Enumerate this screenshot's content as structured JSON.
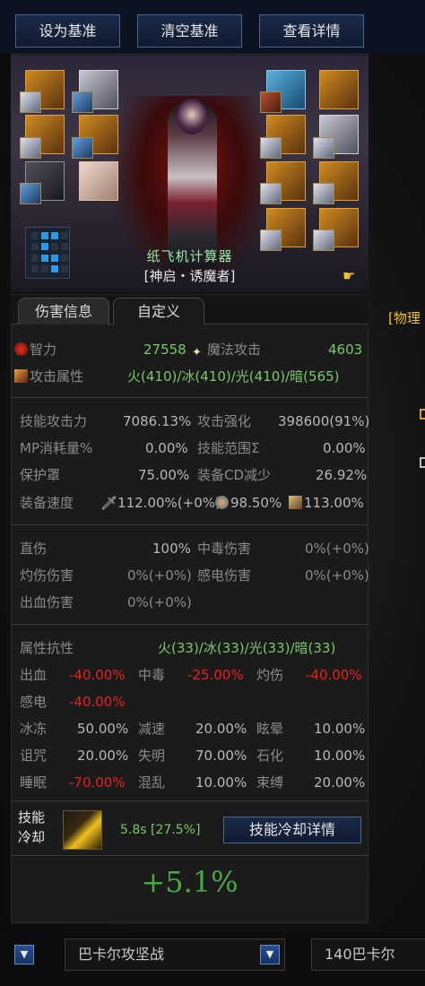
{
  "top_buttons": [
    "设为基准",
    "清空基准",
    "查看详情"
  ],
  "character": {
    "name": "纸飞机计算器",
    "class": "[神启・诱魔者]"
  },
  "tabs": [
    "伤害信息",
    "自定义"
  ],
  "primary": {
    "int_label": "智力",
    "int_value": "27558",
    "matk_label": "魔法攻击",
    "matk_value": "4603",
    "elem_label": "攻击属性",
    "elem_value": "火(410)/冰(410)/光(410)/暗(565)"
  },
  "stats": {
    "skill_atk_label": "技能攻击力",
    "skill_atk_value": "7086.13%",
    "atk_boost_label": "攻击强化",
    "atk_boost_value": "398600(91%)",
    "mp_label": "MP消耗量%",
    "mp_value": "0.00%",
    "range_label": "技能范围Σ",
    "range_value": "0.00%",
    "shield_label": "保护罩",
    "shield_value": "75.00%",
    "cd_label": "装备CD减少",
    "cd_value": "26.92%",
    "speed_label": "装备速度",
    "speed_atk": "112.00%(+0%)",
    "speed_cast": "98.50%",
    "speed_move": "113.00%"
  },
  "damage": {
    "direct_label": "直伤",
    "direct_value": "100%",
    "poison_label": "中毒伤害",
    "poison_value": "0%(+0%)",
    "burn_label": "灼伤伤害",
    "burn_value": "0%(+0%)",
    "shock_label": "感电伤害",
    "shock_value": "0%(+0%)",
    "bleed_label": "出血伤害",
    "bleed_value": "0%(+0%)"
  },
  "resist": {
    "title": "属性抗性",
    "elem_value": "火(33)/冰(33)/光(33)/暗(33)",
    "items": [
      {
        "label": "出血",
        "value": "-40.00%"
      },
      {
        "label": "中毒",
        "value": "-25.00%"
      },
      {
        "label": "灼伤",
        "value": "-40.00%"
      },
      {
        "label": "感电",
        "value": "-40.00%"
      },
      {
        "label": "冰冻",
        "value": "50.00%"
      },
      {
        "label": "减速",
        "value": "20.00%"
      },
      {
        "label": "眩晕",
        "value": "10.00%"
      },
      {
        "label": "诅咒",
        "value": "20.00%"
      },
      {
        "label": "失明",
        "value": "70.00%"
      },
      {
        "label": "石化",
        "value": "10.00%"
      },
      {
        "label": "睡眠",
        "value": "-70.00%"
      },
      {
        "label": "混乱",
        "value": "10.00%"
      },
      {
        "label": "束缚",
        "value": "20.00%"
      }
    ]
  },
  "cooldown": {
    "label_line1": "技能",
    "label_line2": "冷却",
    "value": "5.8s [27.5%]",
    "button": "技能冷却详情"
  },
  "result": "+5.1%",
  "bottom": {
    "dungeon": "巴卡尔攻坚战",
    "level": "140巴卡尔"
  },
  "side_text": "[物理"
}
